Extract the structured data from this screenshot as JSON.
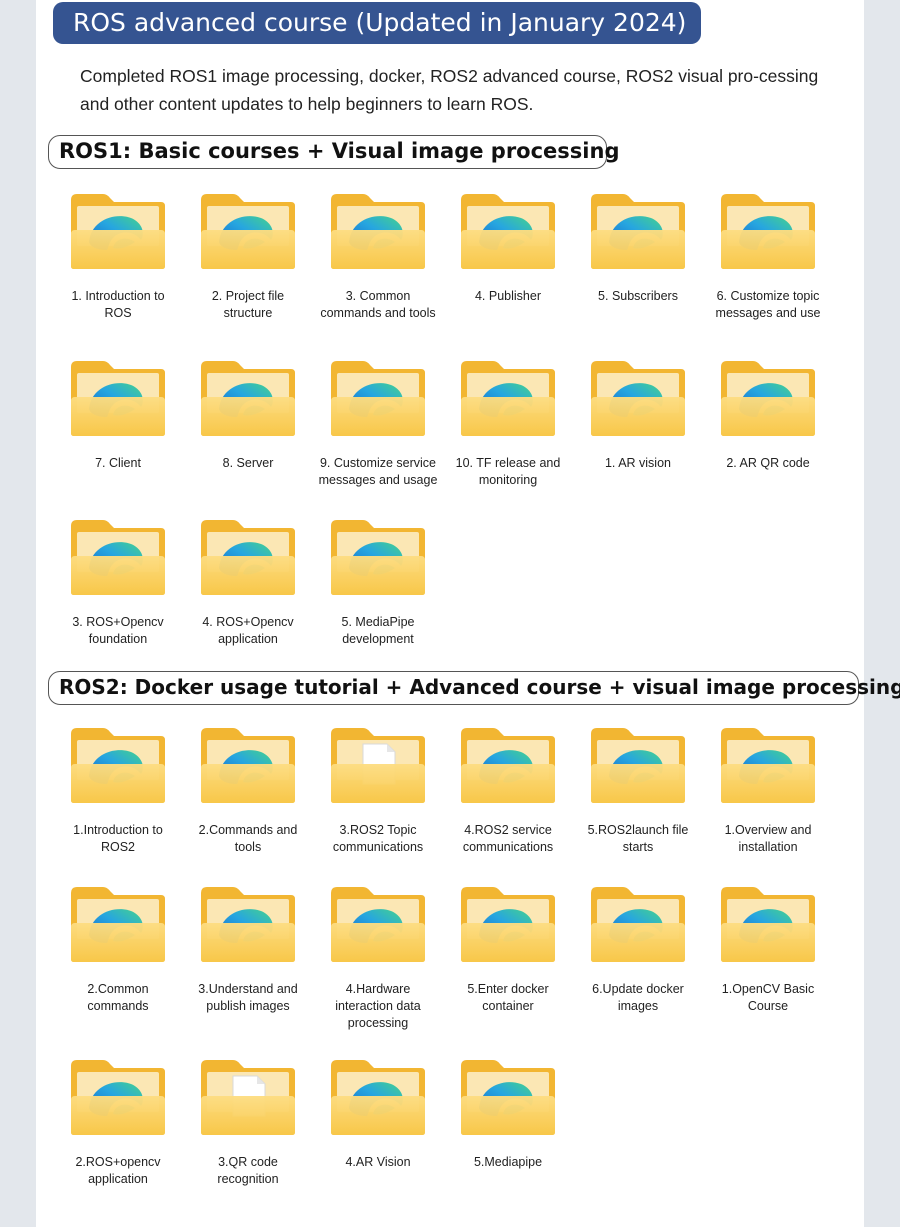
{
  "banner": {
    "title": "ROS advanced course (Updated in January 2024)"
  },
  "intro": {
    "text": "Completed ROS1 image processing, docker, ROS2 advanced course, ROS2 visual pro-cessing and other content updates to help beginners to learn ROS."
  },
  "sections": [
    {
      "title": "ROS1: Basic courses + Visual image processing",
      "items": [
        {
          "label": "1. Introduction to ROS",
          "icon": "folder-edge-icon"
        },
        {
          "label": "2. Project file structure",
          "icon": "folder-edge-icon"
        },
        {
          "label": "3. Common commands and tools",
          "icon": "folder-edge-icon"
        },
        {
          "label": "4. Publisher",
          "icon": "folder-edge-icon"
        },
        {
          "label": "5. Subscribers",
          "icon": "folder-edge-icon"
        },
        {
          "label": "6. Customize topic messages and use",
          "icon": "folder-edge-icon"
        },
        {
          "label": "7. Client",
          "icon": "folder-edge-icon"
        },
        {
          "label": "8. Server",
          "icon": "folder-edge-icon"
        },
        {
          "label": "9. Customize service messages and usage",
          "icon": "folder-edge-icon"
        },
        {
          "label": "10. TF release and monitoring",
          "icon": "folder-edge-icon"
        },
        {
          "label": "1. AR vision",
          "icon": "folder-edge-icon"
        },
        {
          "label": "2. AR QR code",
          "icon": "folder-edge-icon"
        },
        {
          "label": "3. ROS+Opencv foundation",
          "icon": "folder-edge-icon"
        },
        {
          "label": "4. ROS+Opencv application",
          "icon": "folder-edge-icon"
        },
        {
          "label": "5. MediaPipe development",
          "icon": "folder-edge-icon"
        }
      ]
    },
    {
      "title": "ROS2: Docker usage tutorial + Advanced course + visual image processing",
      "items": [
        {
          "label": "1.Introduction to ROS2",
          "icon": "folder-edge-icon"
        },
        {
          "label": "2.Commands and tools",
          "icon": "folder-edge-icon"
        },
        {
          "label": "3.ROS2 Topic communications",
          "icon": "folder-document-icon"
        },
        {
          "label": "4.ROS2 service communications",
          "icon": "folder-edge-icon"
        },
        {
          "label": "5.ROS2launch file starts",
          "icon": "folder-edge-icon"
        },
        {
          "label": "1.Overview and installation",
          "icon": "folder-edge-icon"
        },
        {
          "label": "2.Common commands",
          "icon": "folder-edge-icon"
        },
        {
          "label": "3.Understand and publish images",
          "icon": "folder-edge-icon"
        },
        {
          "label": "4.Hardware interaction data processing",
          "icon": "folder-edge-icon"
        },
        {
          "label": "5.Enter docker container",
          "icon": "folder-edge-icon"
        },
        {
          "label": "6.Update docker images",
          "icon": "folder-edge-icon"
        },
        {
          "label": "1.OpenCV Basic Course",
          "icon": "folder-edge-icon"
        },
        {
          "label": "2.ROS+opencv application",
          "icon": "folder-edge-icon"
        },
        {
          "label": "3.QR code recognition",
          "icon": "folder-document-icon"
        },
        {
          "label": "4.AR Vision",
          "icon": "folder-edge-icon"
        },
        {
          "label": "5.Mediapipe",
          "icon": "folder-edge-icon"
        }
      ]
    }
  ],
  "colors": {
    "banner_bg": "#355491",
    "folder_back": "#F2B632",
    "folder_front": "#FCD66E",
    "edge_blue": "#1A72D6",
    "edge_green": "#3FC98C"
  }
}
